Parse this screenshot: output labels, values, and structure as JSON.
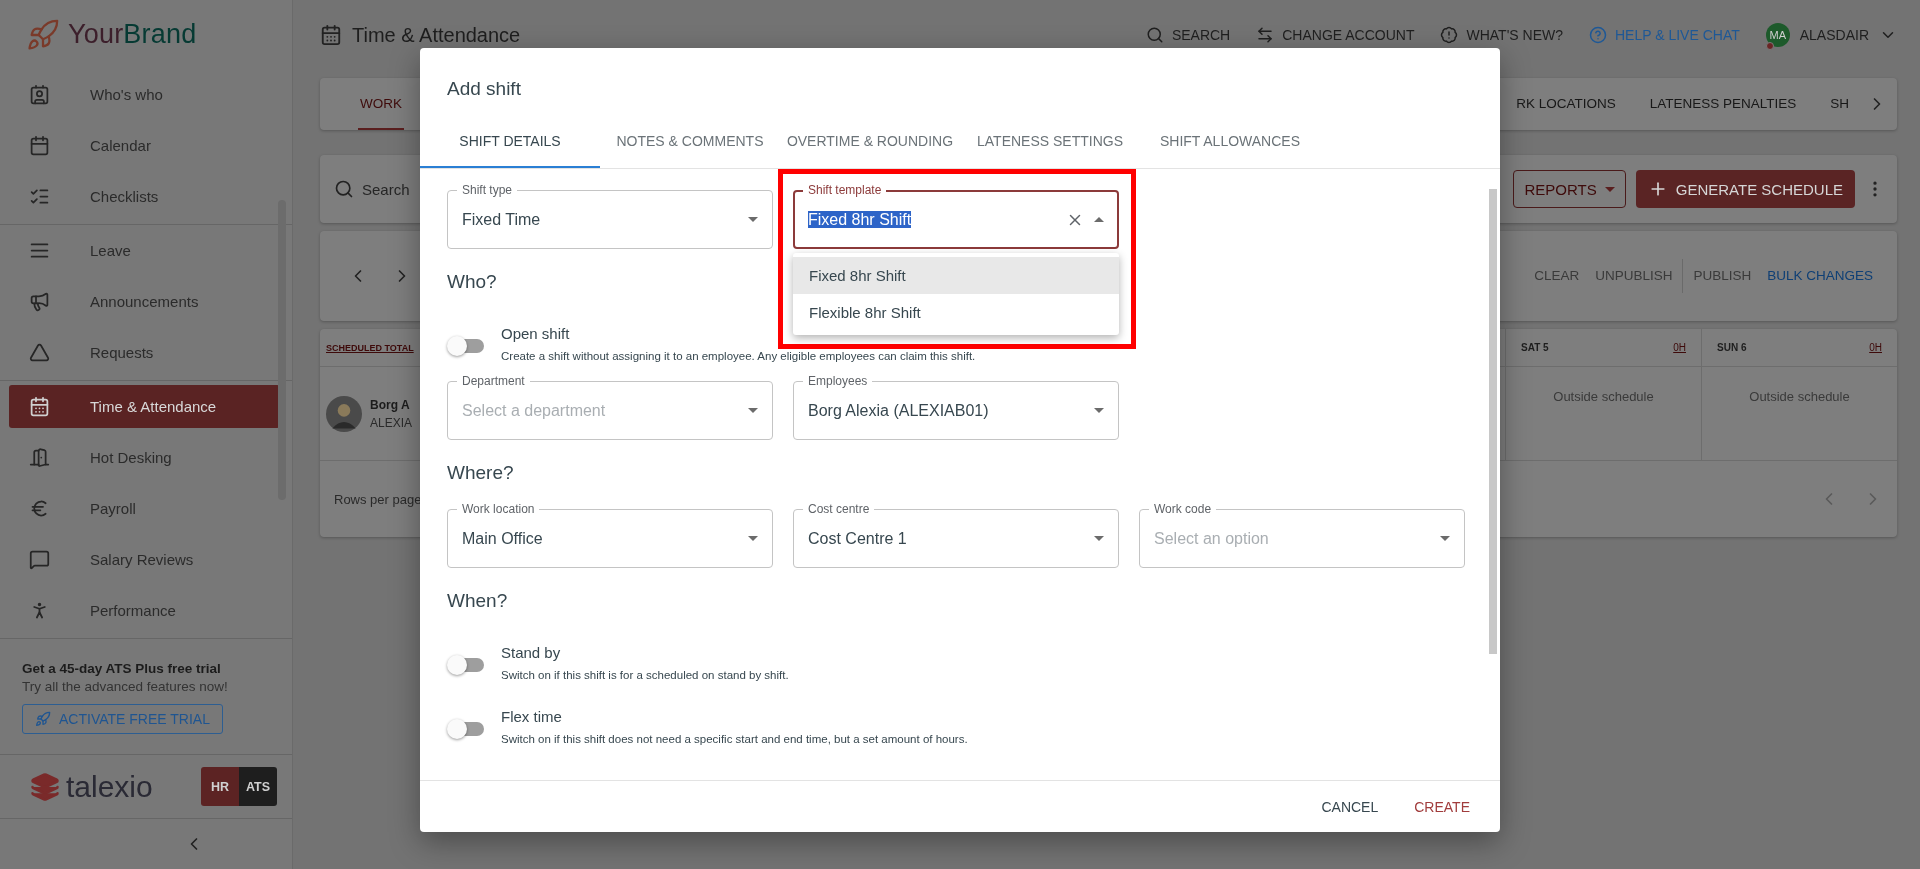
{
  "brand": {
    "parts": [
      "Your",
      "Brand"
    ]
  },
  "sidebar": {
    "sections": [
      {
        "items": [
          {
            "label": "Who's who",
            "selected": false
          },
          {
            "label": "Calendar",
            "selected": false
          },
          {
            "label": "Checklists",
            "selected": false
          }
        ]
      },
      {
        "items": [
          {
            "label": "Leave",
            "selected": false
          },
          {
            "label": "Announcements",
            "selected": false
          },
          {
            "label": "Requests",
            "selected": false
          }
        ]
      },
      {
        "items": [
          {
            "label": "Time & Attendance",
            "selected": true
          },
          {
            "label": "Hot Desking",
            "selected": false
          },
          {
            "label": "Payroll",
            "selected": false
          },
          {
            "label": "Salary Reviews",
            "selected": false
          },
          {
            "label": "Performance",
            "selected": false
          }
        ]
      }
    ]
  },
  "promo": {
    "title": "Get a 45-day ATS Plus free trial",
    "text": "Try all the advanced features now!",
    "button": "ACTIVATE FREE TRIAL"
  },
  "footer": {
    "logo": "talexio",
    "modules": [
      {
        "label": "HR",
        "selected": true
      },
      {
        "label": "ATS",
        "selected": false
      }
    ]
  },
  "header": {
    "title": "Time & Attendance",
    "actions": [
      {
        "label": "SEARCH",
        "highlighted": false
      },
      {
        "label": "CHANGE ACCOUNT",
        "highlighted": false
      },
      {
        "label": "WHAT'S NEW?",
        "highlighted": false
      },
      {
        "label": "HELP & LIVE CHAT",
        "highlighted": true
      }
    ],
    "user": {
      "initials": "MA",
      "name": "ALASDAIR"
    }
  },
  "page_tabs": [
    {
      "label": "WORK",
      "selected": true
    },
    {
      "label": "RK LOCATIONS",
      "selected": false
    },
    {
      "label": "LATENESS PENALTIES",
      "selected": false
    },
    {
      "label": "SH",
      "selected": false
    }
  ],
  "toolbar": {
    "search_placeholder": "Search",
    "reports": "REPORTS",
    "generate": "GENERATE SCHEDULE"
  },
  "schedule_actions": [
    [
      {
        "label": "CLEAR",
        "disabled": true
      },
      {
        "label": "UNPUBLISH",
        "disabled": true
      }
    ],
    [
      {
        "label": "PUBLISH",
        "disabled": true
      },
      {
        "label": "BULK CHANGES",
        "disabled": false
      }
    ]
  ],
  "schedule": {
    "total_label": "SCHEDULED TOTAL",
    "days": [
      {
        "label": "SAT 5",
        "hours": "0H"
      },
      {
        "label": "SUN 6",
        "hours": "0H"
      }
    ],
    "employee": {
      "name": "Borg A",
      "code": "ALEXIA"
    },
    "cells": [
      "Outside schedule",
      "Outside schedule"
    ],
    "rows_per_page": "Rows per page"
  },
  "dialog": {
    "title": "Add shift",
    "tabs": [
      {
        "label": "SHIFT DETAILS",
        "selected": true
      },
      {
        "label": "NOTES & COMMENTS",
        "selected": false
      },
      {
        "label": "OVERTIME & ROUNDING",
        "selected": false
      },
      {
        "label": "LATENESS SETTINGS",
        "selected": false
      },
      {
        "label": "SHIFT ALLOWANCES",
        "selected": false
      }
    ],
    "shift_type": {
      "label": "Shift type",
      "value": "Fixed Time"
    },
    "shift_template": {
      "label": "Shift template",
      "value": "Fixed 8hr Shift",
      "focused": true,
      "highlighted": true,
      "options": [
        {
          "label": "Fixed 8hr Shift",
          "selected": true
        },
        {
          "label": "Flexible 8hr Shift",
          "selected": false
        }
      ]
    },
    "sections": [
      {
        "heading": "Who?",
        "toggles": [
          {
            "label": "Open shift",
            "description": "Create a shift without assigning it to an employee. Any eligible employees can claim this shift.",
            "on": false
          }
        ],
        "fields": [
          {
            "label": "Department",
            "placeholder": "Select a department"
          },
          {
            "label": "Employees",
            "value": "Borg Alexia (ALEXIAB01)"
          }
        ]
      },
      {
        "heading": "Where?",
        "fields": [
          {
            "label": "Work location",
            "value": "Main Office"
          },
          {
            "label": "Cost centre",
            "value": "Cost Centre 1"
          },
          {
            "label": "Work code",
            "placeholder": "Select an option"
          }
        ]
      },
      {
        "heading": "When?",
        "toggles": [
          {
            "label": "Stand by",
            "description": "Switch on if this shift is for a scheduled on stand by shift.",
            "on": false
          },
          {
            "label": "Flex time",
            "description": "Switch on if this shift does not need a specific start and end time, but a set amount of hours.",
            "on": false
          }
        ]
      }
    ],
    "buttons": [
      {
        "label": "CANCEL",
        "kind": "secondary"
      },
      {
        "label": "CREATE",
        "kind": "primary"
      }
    ]
  }
}
